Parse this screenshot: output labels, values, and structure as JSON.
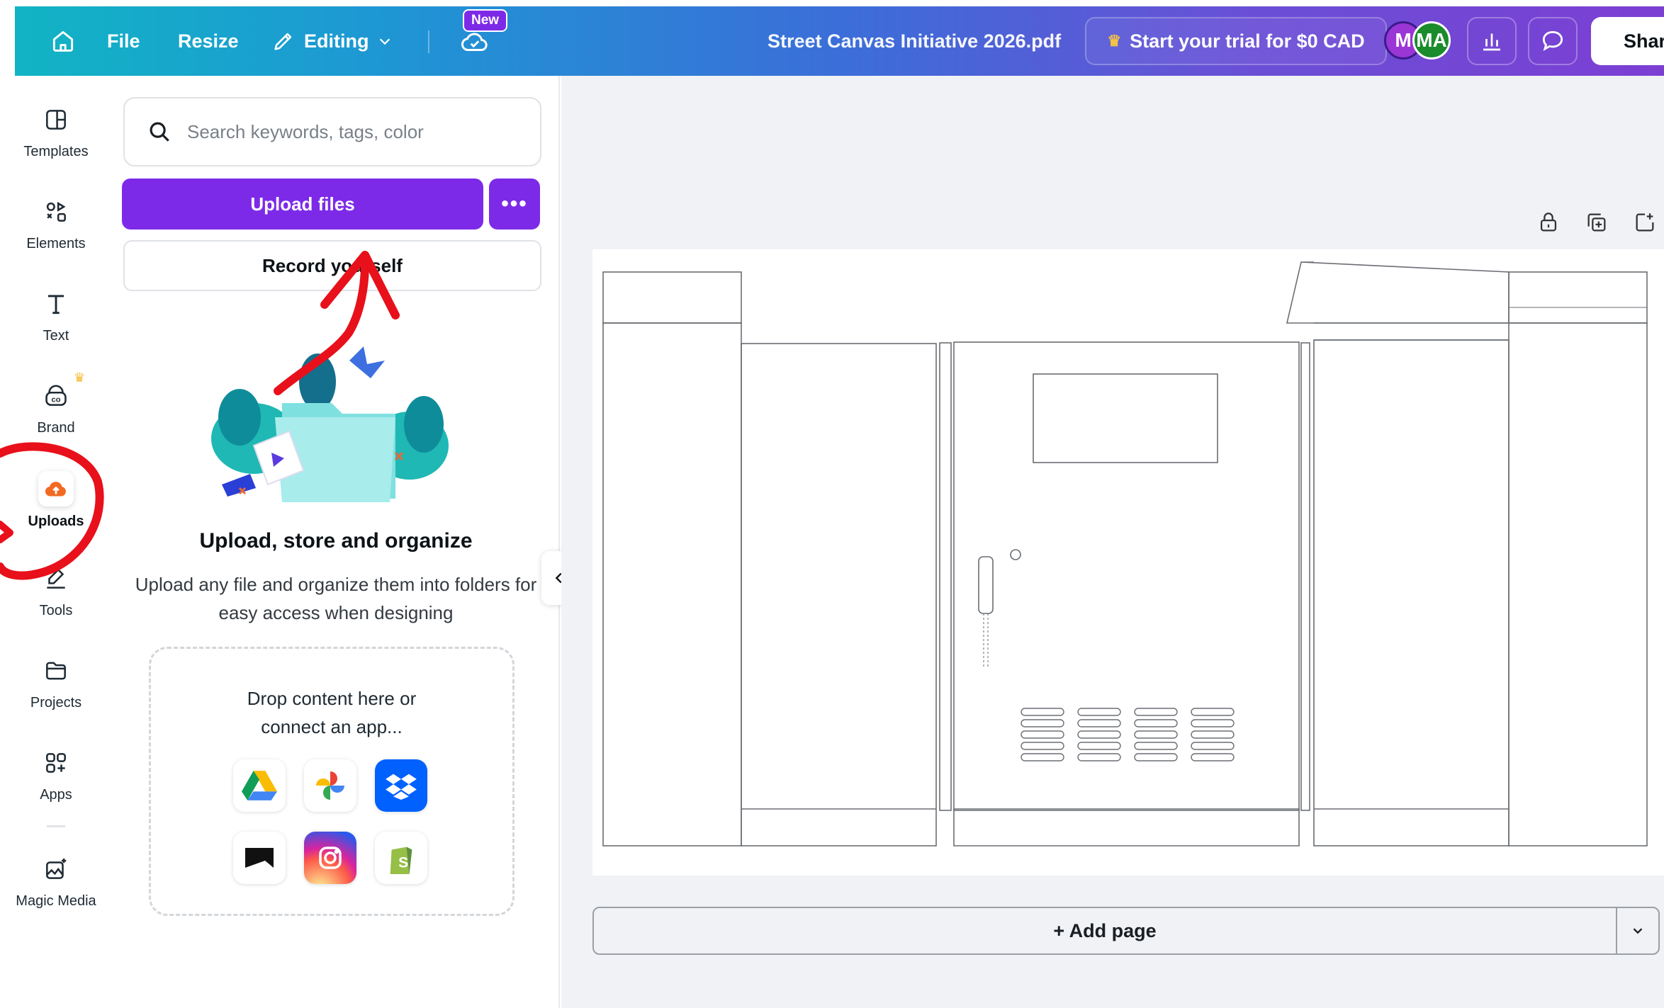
{
  "topbar": {
    "file_label": "File",
    "resize_label": "Resize",
    "editing_label": "Editing",
    "new_badge": "New",
    "doc_title": "Street Canvas Initiative 2026.pdf",
    "trial_label": "Start your trial for $0 CAD",
    "avatars": [
      "M",
      "MA"
    ],
    "share_label": "Share"
  },
  "sidebar": {
    "items": [
      {
        "label": "Templates",
        "icon": "templates-icon"
      },
      {
        "label": "Elements",
        "icon": "elements-icon"
      },
      {
        "label": "Text",
        "icon": "text-icon"
      },
      {
        "label": "Brand",
        "icon": "brand-icon"
      },
      {
        "label": "Uploads",
        "icon": "uploads-icon"
      },
      {
        "label": "Tools",
        "icon": "tools-icon"
      },
      {
        "label": "Projects",
        "icon": "projects-icon"
      },
      {
        "label": "Apps",
        "icon": "apps-icon"
      },
      {
        "label": "Magic Media",
        "icon": "magic-media-icon"
      }
    ],
    "active": "Uploads"
  },
  "panel": {
    "search_placeholder": "Search keywords, tags, color",
    "upload_label": "Upload files",
    "more_label": "•••",
    "record_label": "Record yourself",
    "title": "Upload, store and organize",
    "description": "Upload any file and organize them into folders for easy access when designing",
    "drop_text": "Drop content here or connect an app...",
    "apps": [
      "google-drive-icon",
      "google-photos-icon",
      "dropbox-icon",
      "box-icon",
      "instagram-icon",
      "shopify-icon"
    ]
  },
  "canvas": {
    "add_page_label": "+ Add page"
  },
  "colors": {
    "accent": "#7d2ae8",
    "annotation": "#e8101a"
  }
}
